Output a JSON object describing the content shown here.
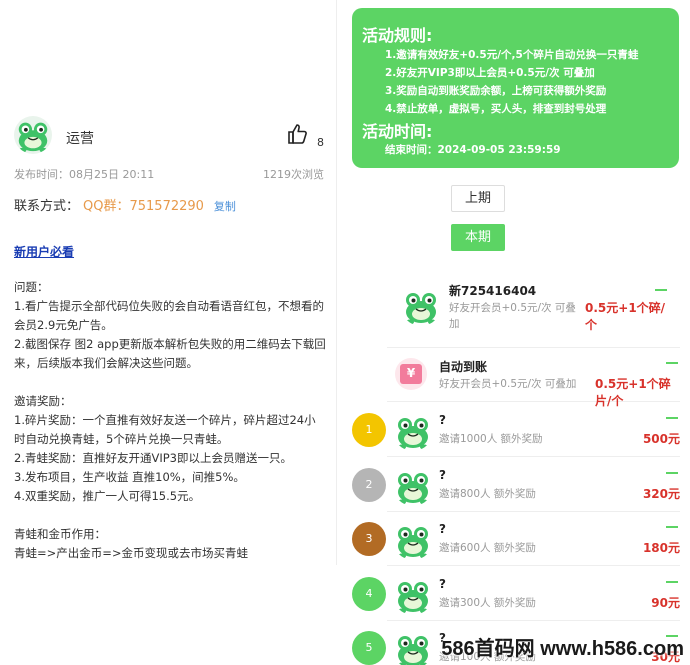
{
  "post": {
    "author": "运营",
    "likes": "8",
    "publish_label": "发布时间：",
    "publish_time": "08月25日 20:11",
    "views": "1219次浏览",
    "contact_label": "联系方式：",
    "contact_value": "QQ群：751572290",
    "copy_label": "复制",
    "new_user_link": "新用户必看",
    "paragraphs": [
      "问题：",
      "1.看广告提示全部代码位失败的会自动看语音红包，不想看的会员2.9元免广告。",
      "2.截图保存 图2 app更新版本解析包失败的用二维码去下载回来，后续版本我们会解决这些问题。",
      "",
      "邀请奖励：",
      "1.碎片奖励：一个直推有效好友送一个碎片，碎片超过24小时自动兑换青蛙，5个碎片兑换一只青蛙。",
      "2.青蛙奖励：直推好友开通VIP3即以上会员赠送一只。",
      "3.发布项目，生产收益 直推10%，间推5%。",
      "4.双重奖励，推广一人可得15.5元。",
      "",
      "青蛙和金币作用：",
      "青蛙=>产出金币=>金币变现或去市场买青蛙"
    ]
  },
  "rules": {
    "title": "活动规则:",
    "items": [
      "1.邀请有效好友+0.5元/个,5个碎片自动兑换一只青蛙",
      "2.好友开VIP3即以上会员+0.5元/次 可叠加",
      "3.奖励自动到账奖励余额，上榜可获得额外奖励",
      "4.禁止放单，虚拟号，买人头，排查到封号处理"
    ],
    "time_title": "活动时间:",
    "end_time": "结束时间：2024-09-05 23:59:59"
  },
  "tabs": {
    "prev": "上期",
    "current": "本期"
  },
  "feed": [
    {
      "title": "新725416404",
      "sub": "好友开会员+0.5元/次 可叠加",
      "reward": "0.5元+1个碎/个"
    },
    {
      "title": "自动到账",
      "sub": "好友开会员+0.5元/次 可叠加",
      "reward": "0.5元+1个碎片/个",
      "icon_char": "¥"
    }
  ],
  "leaderboard": [
    {
      "rank": "1",
      "name": "?",
      "desc": "邀请1000人 额外奖励",
      "reward": "500元"
    },
    {
      "rank": "2",
      "name": "?",
      "desc": "邀请800人 额外奖励",
      "reward": "320元"
    },
    {
      "rank": "3",
      "name": "?",
      "desc": "邀请600人 额外奖励",
      "reward": "180元"
    },
    {
      "rank": "4",
      "name": "?",
      "desc": "邀请300人 额外奖励",
      "reward": "90元"
    },
    {
      "rank": "5",
      "name": "?",
      "desc": "邀请100人 额外奖励",
      "reward": "30元"
    }
  ],
  "watermark": "586首码网 www.h586.com",
  "colors": {
    "accent": "#5cd464",
    "reward": "#d8322b",
    "qq": "#e79a4b",
    "link": "#1a3db3"
  }
}
